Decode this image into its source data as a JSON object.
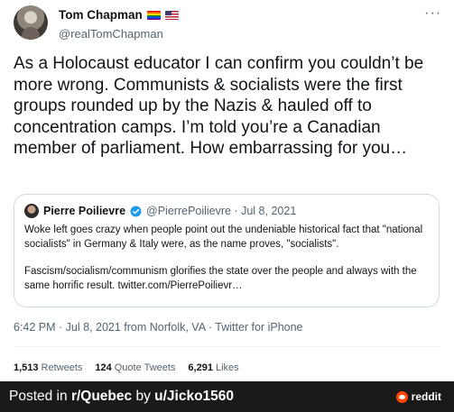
{
  "tweet": {
    "author_name": "Tom Chapman",
    "author_handle": "@realTomChapman",
    "more_label": "···",
    "text": "As a Holocaust educator I can confirm you couldn’t be more wrong. Communists & socialists were the first groups rounded up by the Nazis & hauled off to concentration camps. I’m told you’re a Canadian member of parliament. How embarrassing for you…",
    "timestamp": "6:42 PM · Jul 8, 2021 from Norfolk, VA · Twitter for iPhone",
    "stats": {
      "retweets_count": "1,513",
      "retweets_label": "Retweets",
      "quotes_count": "124",
      "quotes_label": "Quote Tweets",
      "likes_count": "6,291",
      "likes_label": "Likes"
    }
  },
  "quote": {
    "author_name": "Pierre Poilievre",
    "meta": "@PierrePoilievre · Jul 8, 2021",
    "paragraph1": "Woke left goes crazy when people point out the undeniable historical fact that \"national socialists\" in Germany & Italy were, as the name proves, \"socialists\".",
    "paragraph2": "Fascism/socialism/communism glorifies the state over the people and always with the same horrific result. twitter.com/PierrePoilievr…"
  },
  "footer": {
    "posted_in_prefix": "Posted in ",
    "subreddit": "r/Quebec",
    "by_text": " by ",
    "username": "u/Jicko1560",
    "brand": "reddit"
  },
  "colors": {
    "verified_blue": "#1d9bf0",
    "reddit_orange": "#ff4500",
    "footer_bg": "#1a1a1b"
  },
  "icons": [
    "rainbow-flag-icon",
    "us-flag-icon",
    "more-icon",
    "verified-badge-icon",
    "reddit-logo-icon"
  ]
}
